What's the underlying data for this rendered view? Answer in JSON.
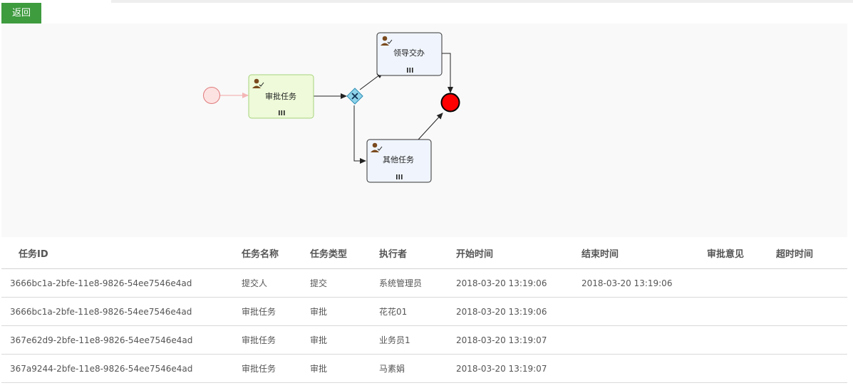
{
  "back_label": "返回",
  "diagram": {
    "nodes": {
      "approve_task": "审批任务",
      "leader_assign": "领导交办",
      "other_task": "其他任务"
    },
    "colors": {
      "start_event": "#fde2e2",
      "end_event": "#ff0000",
      "active_task": "#eefad9",
      "task": "#f0f5fd"
    }
  },
  "table": {
    "headers": [
      "任务ID",
      "任务名称",
      "任务类型",
      "执行者",
      "开始时间",
      "结束时间",
      "审批意见",
      "超时时间"
    ],
    "rows": [
      [
        "3666bc1a-2bfe-11e8-9826-54ee7546e4ad",
        "提交人",
        "提交",
        "系统管理员",
        "2018-03-20 13:19:06",
        "2018-03-20 13:19:06",
        "",
        ""
      ],
      [
        "3666bc1a-2bfe-11e8-9826-54ee7546e4ad",
        "审批任务",
        "审批",
        "花花01",
        "2018-03-20 13:19:06",
        "",
        "",
        ""
      ],
      [
        "367e62d9-2bfe-11e8-9826-54ee7546e4ad",
        "审批任务",
        "审批",
        "业务员1",
        "2018-03-20 13:19:07",
        "",
        "",
        ""
      ],
      [
        "367a9244-2bfe-11e8-9826-54ee7546e4ad",
        "审批任务",
        "审批",
        "马素娟",
        "2018-03-20 13:19:07",
        "",
        "",
        ""
      ]
    ]
  }
}
